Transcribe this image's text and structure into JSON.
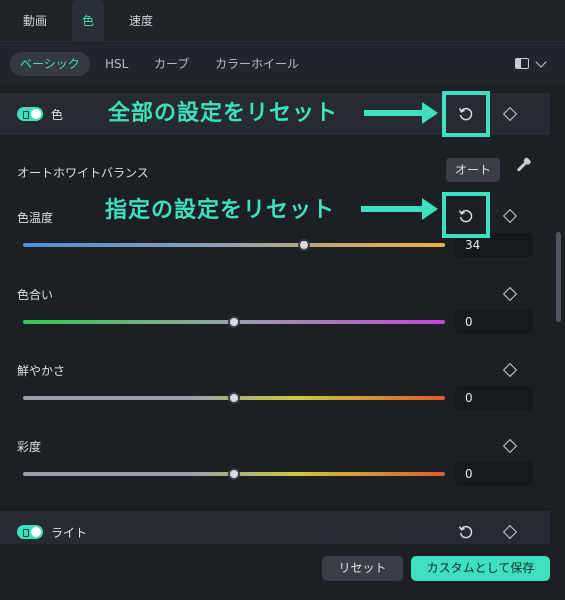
{
  "tabs": [
    {
      "label": "動画"
    },
    {
      "label": "色"
    },
    {
      "label": "速度"
    }
  ],
  "subtabs": [
    {
      "label": "ベーシック"
    },
    {
      "label": "HSL"
    },
    {
      "label": "カーブ"
    },
    {
      "label": "カラーホイール"
    }
  ],
  "color_section": {
    "label": "色",
    "enabled": true
  },
  "white_balance": {
    "label": "オートホワイトバランス",
    "auto_label": "オート"
  },
  "sliders": [
    {
      "label": "色温度",
      "value": "34",
      "level": 0.666
    },
    {
      "label": "色合い",
      "value": "0",
      "level": 0.5
    },
    {
      "label": "鮮やかさ",
      "value": "0",
      "level": 0.5
    },
    {
      "label": "彩度",
      "value": "0",
      "level": 0.5
    }
  ],
  "light_section": {
    "label": "ライト",
    "enabled": true
  },
  "footer": {
    "reset_label": "リセット",
    "save_label": "カスタムとして保存"
  },
  "annotations": {
    "reset_all": "全部の設定をリセット",
    "reset_one": "指定の設定をリセット"
  },
  "colors": {
    "accent": "#3fe0be",
    "background": "#1c1f24"
  }
}
